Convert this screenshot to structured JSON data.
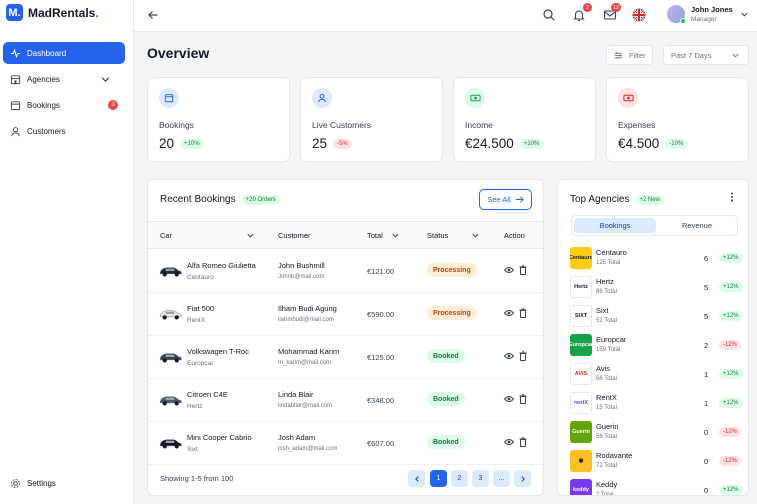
{
  "brand": {
    "name": "MadRentals",
    "mark": "M.",
    "dot": "."
  },
  "sidebar": {
    "items": [
      {
        "label": "Dashboard",
        "icon": "activity-icon",
        "active": true
      },
      {
        "label": "Agencies",
        "icon": "building-icon",
        "has_chevron": true
      },
      {
        "label": "Bookings",
        "icon": "calendar-icon",
        "badge": "3"
      },
      {
        "label": "Customers",
        "icon": "user-icon"
      }
    ],
    "settings": "Settings"
  },
  "topbar": {
    "notifications_badge": "2",
    "messages_badge": "12",
    "user": {
      "name": "John Jones",
      "role": "Manager"
    }
  },
  "page": {
    "title": "Overview",
    "filter_label": "Filter",
    "period": "Past 7 Days"
  },
  "kpis": [
    {
      "label": "Bookings",
      "value": "20",
      "delta": "+10%",
      "trend": "up",
      "icon": "calendar-icon",
      "color": "#2563eb",
      "bg": "#dbeafe"
    },
    {
      "label": "Live Customers",
      "value": "25",
      "delta": "-5%",
      "trend": "down",
      "icon": "user-icon",
      "color": "#2563eb",
      "bg": "#dbeafe"
    },
    {
      "label": "Income",
      "value": "€24.500",
      "delta": "+10%",
      "trend": "up",
      "icon": "cash-icon",
      "color": "#16a34a",
      "bg": "#dcfce7"
    },
    {
      "label": "Expenses",
      "value": "€4.500",
      "delta": "-10%",
      "trend": "up",
      "icon": "cash-icon",
      "color": "#dc2626",
      "bg": "#fee2e2"
    }
  ],
  "recent": {
    "title": "Recent Bookings",
    "badge": "+20 Orders",
    "see_all": "See All",
    "columns": [
      "Car",
      "Customer",
      "Total",
      "Status",
      "Action"
    ],
    "rows": [
      {
        "car": "Alfa Romeo Giulietta",
        "agency": "Centauro",
        "customer": "John Bushmill",
        "email": "Johnb@mail.com",
        "total": "€121.00",
        "status": "Processing"
      },
      {
        "car": "Fiat 500",
        "agency": "RentX",
        "customer": "Ilham Budi Agung",
        "email": "ilahmbudi@mail.com",
        "total": "€590.00",
        "status": "Processing"
      },
      {
        "car": "Volkswagen T-Roc",
        "agency": "Europcar",
        "customer": "Mohammad Karim",
        "email": "m_karim@mail.com",
        "total": "€125.00",
        "status": "Booked"
      },
      {
        "car": "Citroen C4E",
        "agency": "Hertz",
        "customer": "Linda Blair",
        "email": "lindablair@mail.com",
        "total": "€348.00",
        "status": "Booked"
      },
      {
        "car": "Mini Cooper Cabrio",
        "agency": "Sixt",
        "customer": "Josh Adam",
        "email": "josh_adam@mail.com",
        "total": "€607.00",
        "status": "Booked"
      }
    ],
    "footer": "Showing 1-5 from 100",
    "pages": [
      "1",
      "2",
      "3",
      "..."
    ]
  },
  "top_agencies": {
    "title": "Top Agencies",
    "badge": "+2 New",
    "tabs": [
      "Bookings",
      "Revenue"
    ],
    "rows": [
      {
        "name": "Centauro",
        "total": "125 Total",
        "count": "6",
        "delta": "+12%",
        "trend": "up",
        "logo_text": "Centauro",
        "logo_bg": "#facc15",
        "logo_fg": "#111827"
      },
      {
        "name": "Hertz",
        "total": "86 Total",
        "count": "5",
        "delta": "+12%",
        "trend": "up",
        "logo_text": "Hertz",
        "logo_bg": "#ffffff",
        "logo_fg": "#111827"
      },
      {
        "name": "Sixt",
        "total": "52 Total",
        "count": "5",
        "delta": "+12%",
        "trend": "up",
        "logo_text": "SIXT",
        "logo_bg": "#ffffff",
        "logo_fg": "#111827"
      },
      {
        "name": "Europcar",
        "total": "159 Total",
        "count": "2",
        "delta": "-12%",
        "trend": "down",
        "logo_text": "Europcar",
        "logo_bg": "#16a34a",
        "logo_fg": "#ffffff"
      },
      {
        "name": "Avis",
        "total": "56 Total",
        "count": "1",
        "delta": "+12%",
        "trend": "up",
        "logo_text": "AVIS",
        "logo_bg": "#ffffff",
        "logo_fg": "#dc2626"
      },
      {
        "name": "RentX",
        "total": "15 Total",
        "count": "1",
        "delta": "+12%",
        "trend": "up",
        "logo_text": "rentX",
        "logo_bg": "#ffffff",
        "logo_fg": "#4f46e5"
      },
      {
        "name": "Guerin",
        "total": "56 Total",
        "count": "0",
        "delta": "-12%",
        "trend": "down",
        "logo_text": "Guerin",
        "logo_bg": "#65a30d",
        "logo_fg": "#ffffff"
      },
      {
        "name": "Rodavante",
        "total": "72 Total",
        "count": "0",
        "delta": "-12%",
        "trend": "down",
        "logo_text": "◉",
        "logo_bg": "#fbbf24",
        "logo_fg": "#111827"
      },
      {
        "name": "Keddy",
        "total": "2 Total",
        "count": "0",
        "delta": "+12%",
        "trend": "up",
        "logo_text": "keddy",
        "logo_bg": "#7c3aed",
        "logo_fg": "#ffffff"
      }
    ]
  }
}
